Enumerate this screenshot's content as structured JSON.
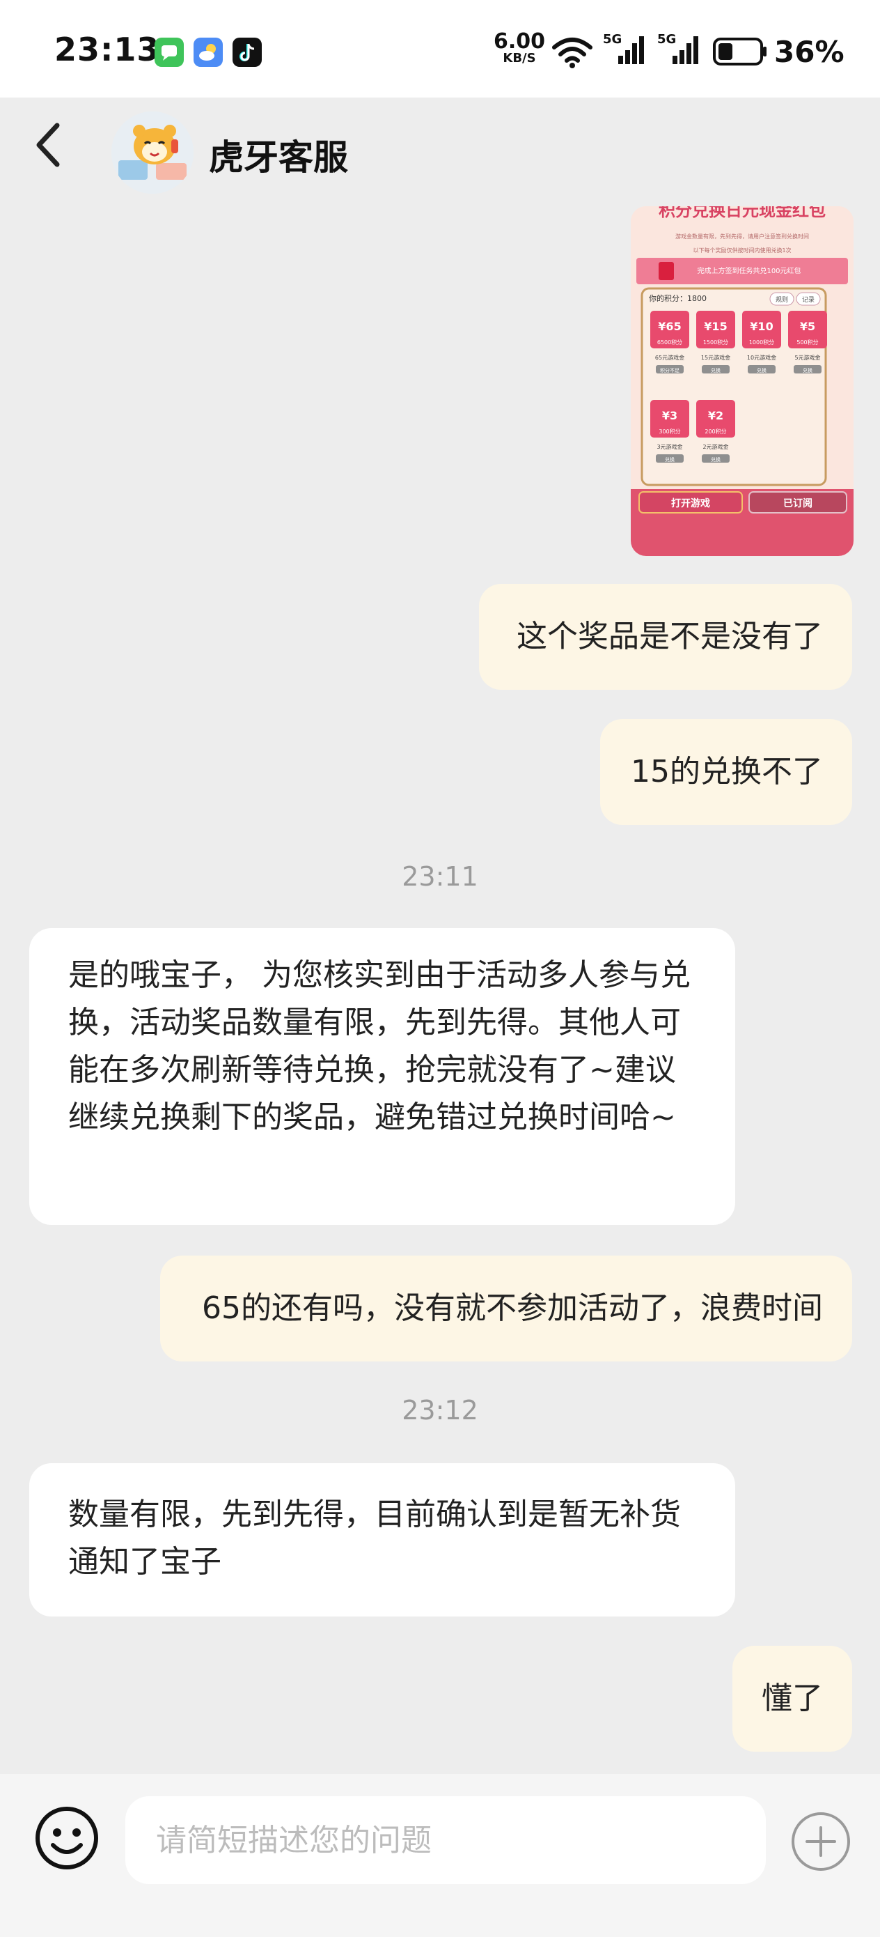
{
  "status_bar": {
    "time": "23:13",
    "net_speed_value": "6.00",
    "net_speed_unit": "KB/S",
    "signal_1_label": "5G",
    "signal_2_label": "5G",
    "battery_percent": "36%",
    "battery_level": 0.36,
    "app_icons": [
      "messages-icon",
      "weather-icon",
      "tiktok-icon"
    ]
  },
  "header": {
    "title": "虎牙客服"
  },
  "shared_image": {
    "banner": "积分兑换日元现金红包",
    "subtitle": "游戏金数量有限，先到先得，请用户注意签到兑换时间",
    "notice": "以下每个奖励仅供按时间内使用兑换1次",
    "task": "完成上方签到任务共兑100元红包",
    "points_label": "你的积分：1800",
    "rules_btn": "规则",
    "records_btn": "记录",
    "prizes": [
      {
        "amount": "65",
        "cost": "6500积分",
        "name": "65元游戏金",
        "status": "积分不足"
      },
      {
        "amount": "15",
        "cost": "1500积分",
        "name": "15元游戏金",
        "status": "兑换"
      },
      {
        "amount": "10",
        "cost": "1000积分",
        "name": "10元游戏金",
        "status": "兑换"
      },
      {
        "amount": "5",
        "cost": "500积分",
        "name": "5元游戏金",
        "status": "兑换"
      },
      {
        "amount": "3",
        "cost": "300积分",
        "name": "3元游戏金",
        "status": "兑换"
      },
      {
        "amount": "2",
        "cost": "200积分",
        "name": "2元游戏金",
        "status": "兑换"
      }
    ],
    "open_game_btn": "打开游戏",
    "subscribed_btn": "已订阅"
  },
  "messages": [
    {
      "side": "out",
      "text": "这个奖品是不是没有了"
    },
    {
      "side": "out",
      "text": "15的兑换不了"
    },
    {
      "type": "time",
      "text": "23:11"
    },
    {
      "side": "in",
      "text": "是的哦宝子，  为您核实到由于活动多人参与兑换，活动奖品数量有限，先到先得。其他人可能在多次刷新等待兑换，抢完就没有了~建议继续兑换剩下的奖品，避免错过兑换时间哈~"
    },
    {
      "side": "out",
      "text": "65的还有吗，没有就不参加活动了，浪费时间"
    },
    {
      "type": "time",
      "text": "23:12"
    },
    {
      "side": "in",
      "text": " 数量有限，先到先得，目前确认到是暂无补货通知了宝子"
    },
    {
      "side": "out",
      "text": "懂了"
    }
  ],
  "input_bar": {
    "placeholder": "请简短描述您的问题"
  },
  "colors": {
    "outgoing_bubble": "#fdf6e5",
    "incoming_bubble": "#ffffff",
    "background": "#ededed",
    "prize_red": "#e84a6d"
  }
}
